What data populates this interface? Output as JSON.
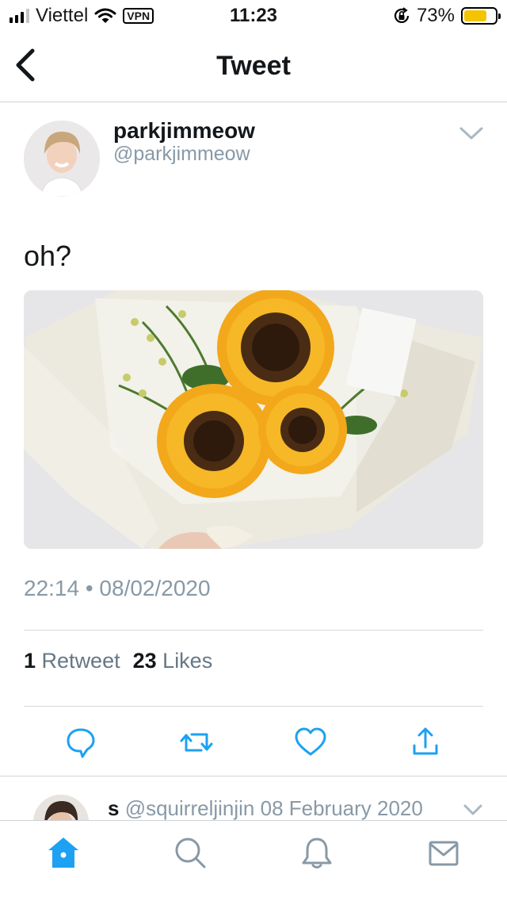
{
  "status_bar": {
    "carrier": "Viettel",
    "vpn": "VPN",
    "time": "11:23",
    "battery": "73%",
    "battery_level": 0.73
  },
  "nav": {
    "title": "Tweet"
  },
  "tweet": {
    "display_name": "parkjimmeow",
    "handle": "@parkjimmeow",
    "text": "oh?",
    "timestamp": "22:14 • 08/02/2020",
    "retweet_count": "1",
    "retweet_label": "Retweet",
    "like_count": "23",
    "like_label": "Likes"
  },
  "reply": {
    "name_fragment": "s",
    "handle": "@squirreljinjin",
    "date": "08 February 2020"
  },
  "colors": {
    "accent": "#1da1f2",
    "secondary_text": "#8899a6",
    "battery": "#f5c400"
  },
  "icons": {
    "actions": [
      "reply-icon",
      "retweet-icon",
      "like-icon",
      "share-icon"
    ],
    "tabs": [
      "home-icon",
      "search-icon",
      "notifications-icon",
      "messages-icon"
    ]
  }
}
